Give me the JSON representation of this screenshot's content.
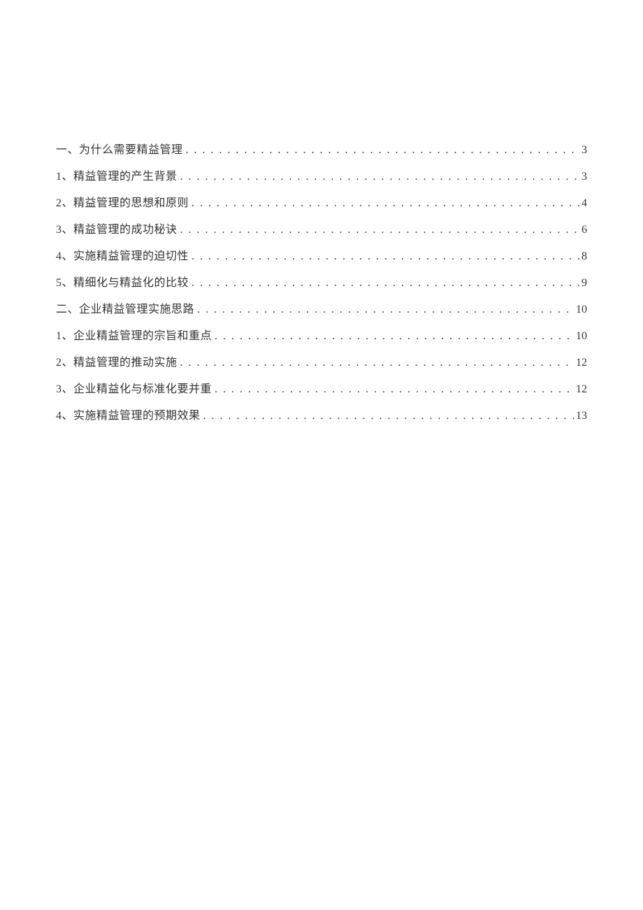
{
  "toc": [
    {
      "title": "一、为什么需要精益管理",
      "page": "3"
    },
    {
      "title": "1、精益管理的产生背景",
      "page": "3"
    },
    {
      "title": "2、精益管理的思想和原则",
      "page": "4"
    },
    {
      "title": "3、精益管理的成功秘诀",
      "page": "6"
    },
    {
      "title": "4、实施精益管理的迫切性",
      "page": "8"
    },
    {
      "title": "5、精细化与精益化的比较",
      "page": "9"
    },
    {
      "title": "二、企业精益管理实施思路",
      "page": "10"
    },
    {
      "title": "1、企业精益管理的宗旨和重点",
      "page": "10"
    },
    {
      "title": "2、精益管理的推动实施",
      "page": "12"
    },
    {
      "title": "3、企业精益化与标准化要并重",
      "page": "12"
    },
    {
      "title": "4、实施精益管理的预期效果",
      "page": "13"
    }
  ]
}
